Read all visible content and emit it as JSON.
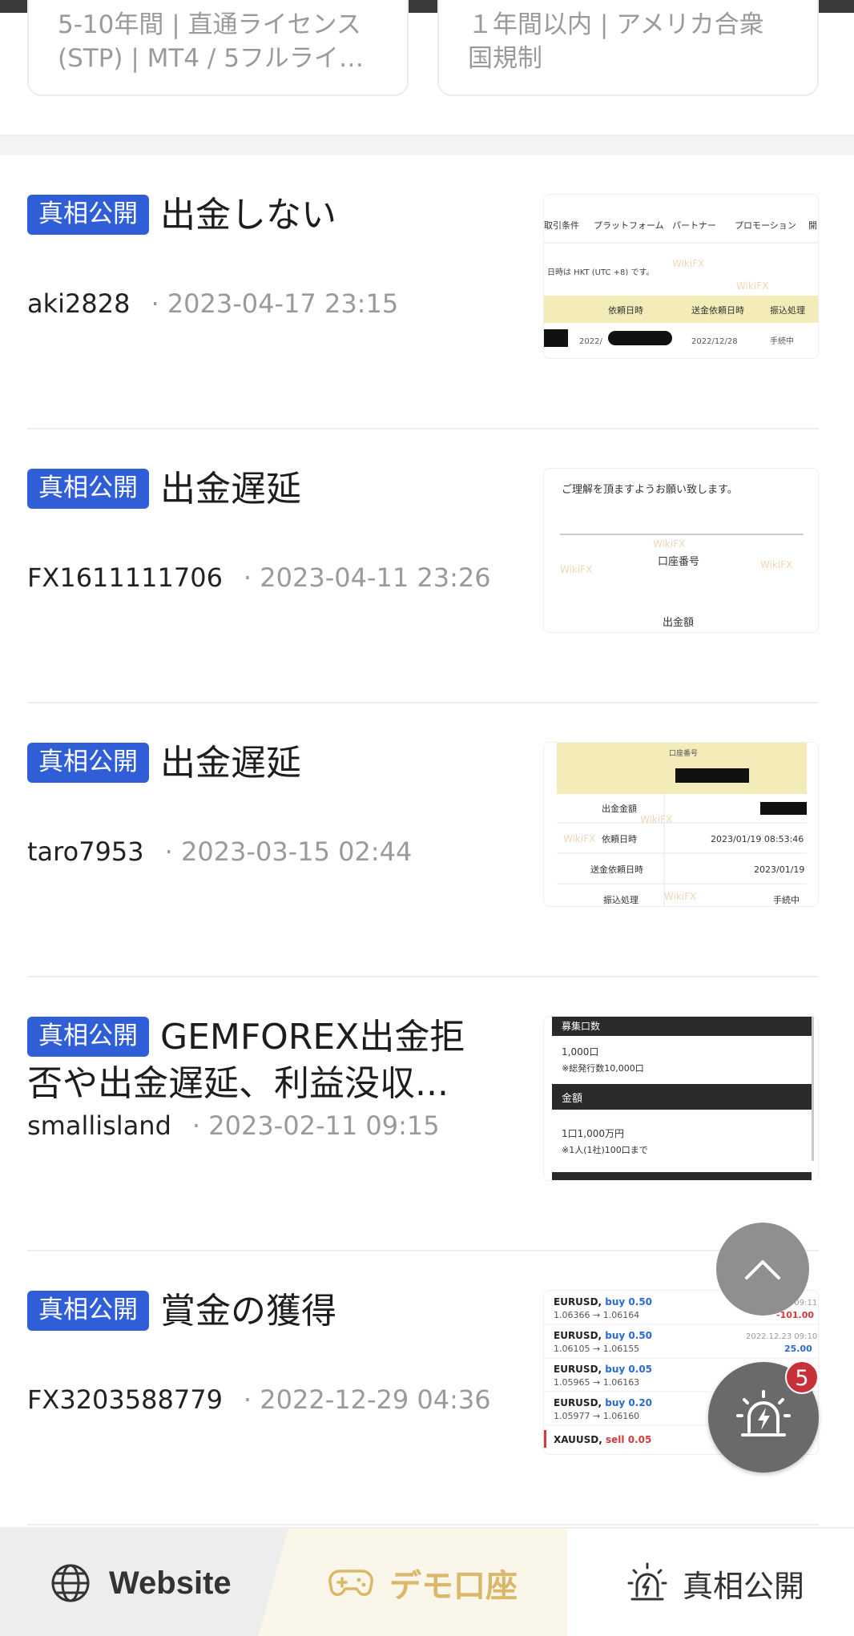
{
  "top_cards": [
    {
      "line1": "5-10年間 | 直通ライセンス",
      "line2": "(STP) | MT4 / 5フルライセ..."
    },
    {
      "line1": "１年間以内 | アメリカ合衆",
      "line2": "国規制"
    }
  ],
  "badge_label": "真相公開",
  "posts": [
    {
      "title": "出金しない",
      "user": "aki2828",
      "date": "· 2023-04-17 23:15",
      "thumb": {
        "headers": [
          "取引条件",
          "プラットフォーム",
          "パートナー",
          "プロモーション",
          "開"
        ],
        "note": "日時は HKT (UTC +8) です。",
        "cols": [
          "依頼日時",
          "送金依頼日時",
          "振込処理"
        ],
        "row": [
          "2022/",
          "2022/12/28",
          "手続中"
        ],
        "watermark": "WikiFX"
      }
    },
    {
      "title": "出金遅延",
      "user": "FX1611111706",
      "date": "· 2023-04-11 23:26",
      "thumb": {
        "line1": "ご理解を頂ますようお願い致します。",
        "label1": "口座番号",
        "label2": "出金額",
        "watermark": "WikiFX"
      }
    },
    {
      "title": "出金遅延",
      "user": "taro7953",
      "date": "· 2023-03-15 02:44",
      "thumb": {
        "header": "口座番号",
        "rows": [
          [
            "出金金額",
            ""
          ],
          [
            "依頼日時",
            "2023/01/19 08:53:46"
          ],
          [
            "送金依頼日時",
            "2023/01/19"
          ],
          [
            "振込処理",
            "手続中"
          ]
        ],
        "watermark": "WikiFX"
      }
    },
    {
      "title": "GEMFOREX出金拒否や出金遅延、利益没収...",
      "user": "smallisland",
      "date": "· 2023-02-11 09:15",
      "thumb": {
        "bar1": "募集口数",
        "text1": "1,000口",
        "text2": "※総発行数10,000口",
        "bar2": "金額",
        "text3": "1口1,000万円",
        "text4": "※1人(1社)100口まで"
      }
    },
    {
      "title": "賞金の獲得",
      "user": "FX3203588779",
      "date": "· 2022-12-29 04:36",
      "thumb": {
        "trades": [
          {
            "pair": "EURUSD,",
            "side": "buy 0.50",
            "prices": "1.06366 → 1.06164",
            "time": "2022.12.23 09:11",
            "pl": "-101.00"
          },
          {
            "pair": "EURUSD,",
            "side": "buy 0.50",
            "prices": "1.06105 → 1.06155",
            "time": "2022.12.23 09:10",
            "pl": "25.00"
          },
          {
            "pair": "EURUSD,",
            "side": "buy 0.05",
            "prices": "1.05965 → 1.06163",
            "time": "",
            "pl": ""
          },
          {
            "pair": "EURUSD,",
            "side": "buy 0.20",
            "prices": "1.05977 → 1.06160",
            "time": "",
            "pl": ""
          },
          {
            "pair": "XAUUSD,",
            "side": "sell 0.05",
            "prices": "",
            "time": "",
            "pl": ""
          }
        ]
      }
    }
  ],
  "notification_count": "5",
  "bottom_nav": {
    "website": "Website",
    "demo": "デモ口座",
    "exposure": "真相公開"
  },
  "colors": {
    "badge": "#2f5ed7",
    "demo_gold": "#d9b969",
    "alert_red": "#c8303a"
  }
}
